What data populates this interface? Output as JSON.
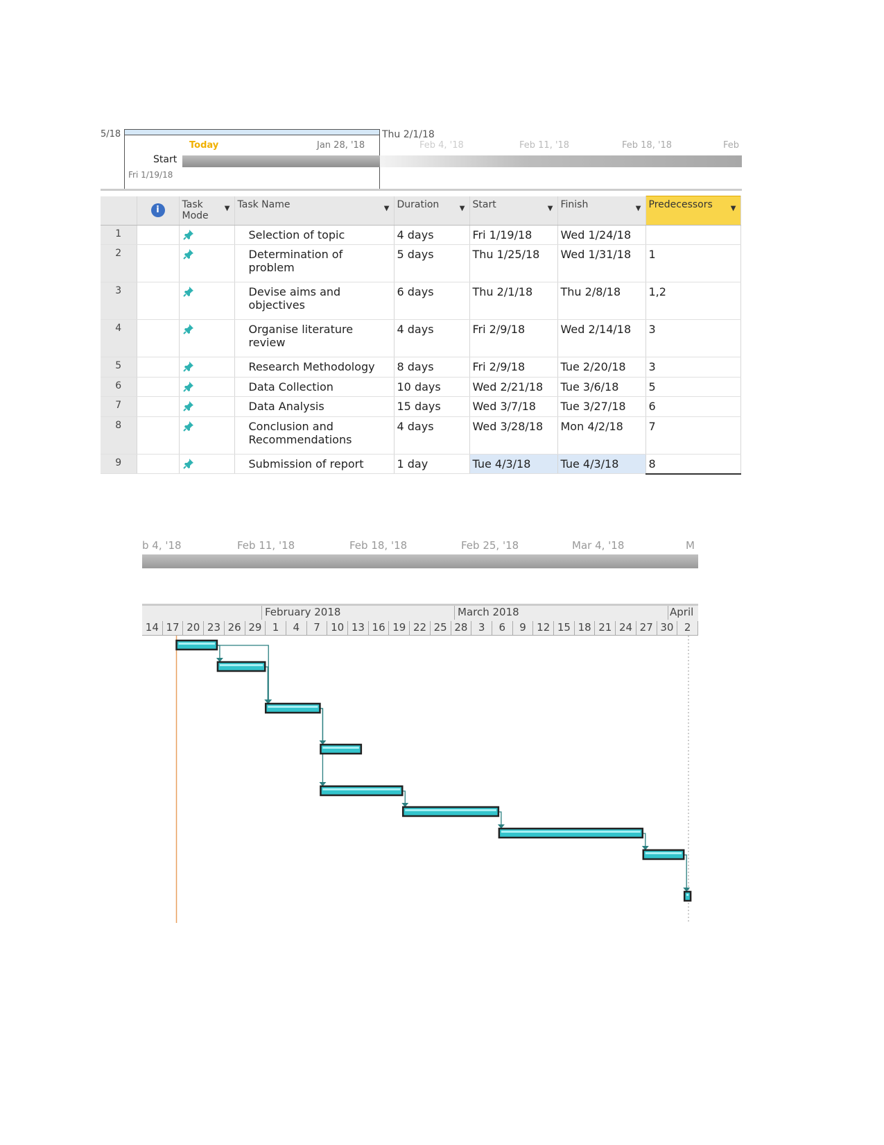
{
  "timeline": {
    "left_cut": "5/18",
    "range_start_label": "Start",
    "range_start_date": "Fri 1/19/18",
    "today_label": "Today",
    "range_end": "Thu 2/1/18",
    "ticks": [
      "Jan 28, '18",
      "Feb 4, '18",
      "Feb 11, '18",
      "Feb 18, '18",
      "Feb"
    ]
  },
  "table": {
    "headers": {
      "mode": "Task Mode",
      "name": "Task Name",
      "duration": "Duration",
      "start": "Start",
      "finish": "Finish",
      "predecessors": "Predecessors"
    },
    "rows": [
      {
        "id": "1",
        "name": "Selection of topic",
        "duration": "4 days",
        "start": "Fri 1/19/18",
        "finish": "Wed 1/24/18",
        "pred": ""
      },
      {
        "id": "2",
        "name": "Determination of problem",
        "duration": "5 days",
        "start": "Thu 1/25/18",
        "finish": "Wed 1/31/18",
        "pred": "1"
      },
      {
        "id": "3",
        "name": "Devise aims and objectives",
        "duration": "6 days",
        "start": "Thu 2/1/18",
        "finish": "Thu 2/8/18",
        "pred": "1,2"
      },
      {
        "id": "4",
        "name": "Organise literature review",
        "duration": "4 days",
        "start": "Fri 2/9/18",
        "finish": "Wed 2/14/18",
        "pred": "3"
      },
      {
        "id": "5",
        "name": "Research Methodology",
        "duration": "8 days",
        "start": "Fri 2/9/18",
        "finish": "Tue 2/20/18",
        "pred": "3"
      },
      {
        "id": "6",
        "name": "Data Collection",
        "duration": "10 days",
        "start": "Wed 2/21/18",
        "finish": "Tue 3/6/18",
        "pred": "5"
      },
      {
        "id": "7",
        "name": "Data Analysis",
        "duration": "15 days",
        "start": "Wed 3/7/18",
        "finish": "Tue 3/27/18",
        "pred": "6"
      },
      {
        "id": "8",
        "name": "Conclusion and Recommendations",
        "duration": "4 days",
        "start": "Wed 3/28/18",
        "finish": "Mon 4/2/18",
        "pred": "7"
      },
      {
        "id": "9",
        "name": "Submission of report",
        "duration": "1 day",
        "start": "Tue 4/3/18",
        "finish": "Tue 4/3/18",
        "pred": "8"
      }
    ]
  },
  "timeline2": {
    "ticks": [
      "b 4, '18",
      "Feb 11, '18",
      "Feb 18, '18",
      "Feb 25, '18",
      "Mar 4, '18",
      "M"
    ]
  },
  "gantt": {
    "months": [
      "February 2018",
      "March 2018",
      "April"
    ],
    "days": [
      "14",
      "17",
      "20",
      "23",
      "26",
      "29",
      "1",
      "4",
      "7",
      "10",
      "13",
      "16",
      "19",
      "22",
      "25",
      "28",
      "3",
      "6",
      "9",
      "12",
      "15",
      "18",
      "21",
      "24",
      "27",
      "30",
      "2"
    ],
    "bar_color": "#33c4cc",
    "tasks": [
      {
        "start": "2018-01-19",
        "finish": "2018-01-24"
      },
      {
        "start": "2018-01-25",
        "finish": "2018-01-31"
      },
      {
        "start": "2018-02-01",
        "finish": "2018-02-08"
      },
      {
        "start": "2018-02-09",
        "finish": "2018-02-14"
      },
      {
        "start": "2018-02-09",
        "finish": "2018-02-20"
      },
      {
        "start": "2018-02-21",
        "finish": "2018-03-06"
      },
      {
        "start": "2018-03-07",
        "finish": "2018-03-27"
      },
      {
        "start": "2018-03-28",
        "finish": "2018-04-02"
      },
      {
        "start": "2018-04-03",
        "finish": "2018-04-03"
      }
    ]
  }
}
